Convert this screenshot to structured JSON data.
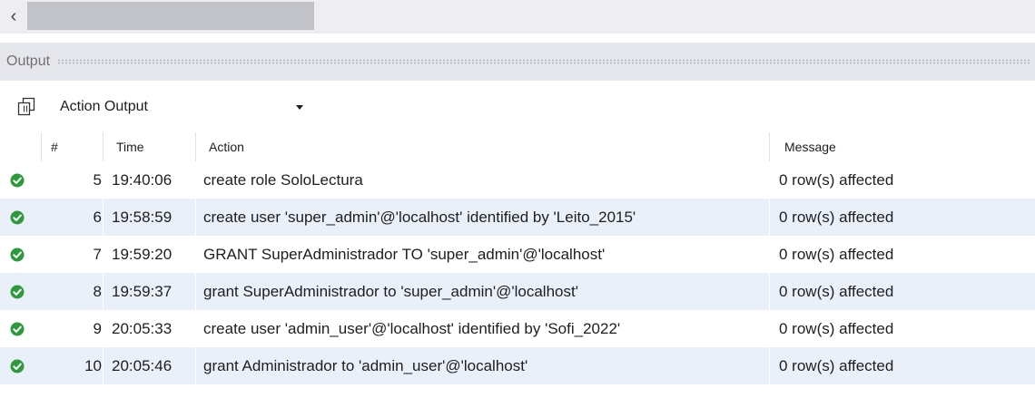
{
  "scrollbar": {
    "left_arrow": "‹"
  },
  "output_panel": {
    "title": "Output",
    "selector": {
      "value": "Action Output"
    }
  },
  "table": {
    "columns": [
      "#",
      "Time",
      "Action",
      "Message"
    ],
    "rows": [
      {
        "status": "success",
        "num": "5",
        "time": "19:40:06",
        "action": "create role SoloLectura",
        "message": "0 row(s) affected"
      },
      {
        "status": "success",
        "num": "6",
        "time": "19:58:59",
        "action": "create user 'super_admin'@'localhost' identified by 'Leito_2015'",
        "message": "0 row(s) affected"
      },
      {
        "status": "success",
        "num": "7",
        "time": "19:59:20",
        "action": "GRANT SuperAdministrador TO 'super_admin'@'localhost'",
        "message": "0 row(s) affected"
      },
      {
        "status": "success",
        "num": "8",
        "time": "19:59:37",
        "action": "grant SuperAdministrador to 'super_admin'@'localhost'",
        "message": "0 row(s) affected"
      },
      {
        "status": "success",
        "num": "9",
        "time": "20:05:33",
        "action": "create user 'admin_user'@'localhost' identified by 'Sofi_2022'",
        "message": "0 row(s) affected"
      },
      {
        "status": "success",
        "num": "10",
        "time": "20:05:46",
        "action": "grant Administrador to 'admin_user'@'localhost'",
        "message": "0 row(s) affected"
      }
    ]
  },
  "colors": {
    "success": "#2e9a3b",
    "row_alt": "#eaf0fa",
    "header_bg": "#e6e7ed"
  }
}
